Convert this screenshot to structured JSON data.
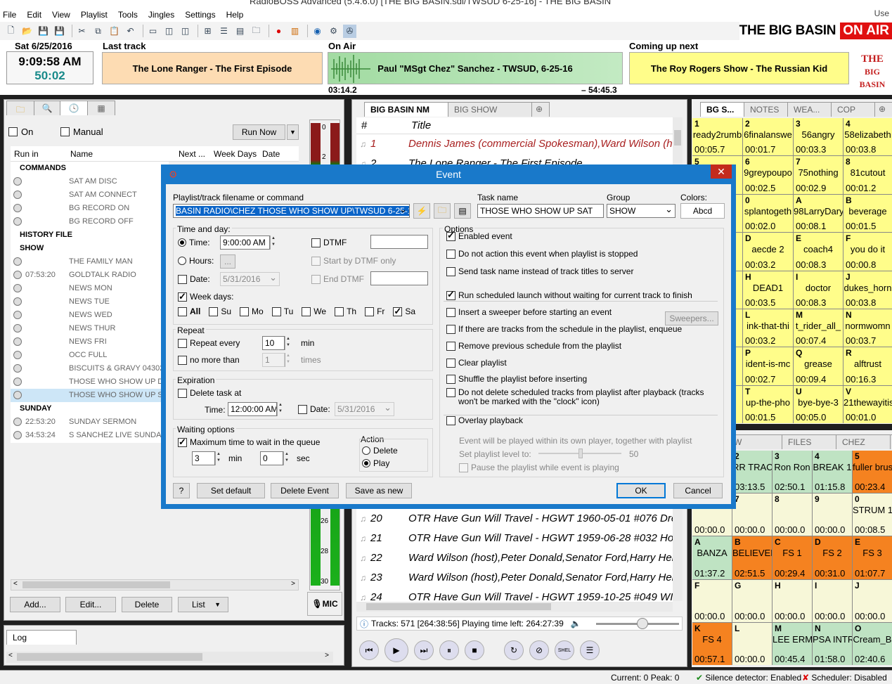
{
  "window": {
    "title": "RadioBOSS Advanced (5.4.6.0) [THE BIG BASIN.sdl/TWSUD 6-25-16] - THE BIG BASIN",
    "user_label": "Use"
  },
  "menu": [
    "File",
    "Edit",
    "View",
    "Playlist",
    "Tools",
    "Jingles",
    "Settings",
    "Help"
  ],
  "station": {
    "name": "THE BIG BASIN",
    "on_air_label": "ON AIR",
    "logo_line1": "THE",
    "logo_line2": "BIG BASIN"
  },
  "clock": {
    "date": "Sat 6/25/2016",
    "time": "9:09:58 AM",
    "countdown": "50:02"
  },
  "last_track": {
    "label": "Last track",
    "title": "The Lone Ranger - The First Episode"
  },
  "on_air": {
    "label": "On Air",
    "title": "Paul \"MSgt Chez\" Sanchez - TWSUD, 6-25-16",
    "elapsed": "03:14.2",
    "remaining": "– 54:45.3"
  },
  "coming_up": {
    "label": "Coming up next",
    "title": "The Roy Rogers Show - The Russian Kid"
  },
  "left_panel": {
    "on_label": "On",
    "manual_label": "Manual",
    "run_now": "Run Now",
    "columns": [
      "Run in",
      "Name",
      "Next ...",
      "Week Days",
      "Date"
    ],
    "rows": [
      {
        "type": "group",
        "name": "COMMANDS"
      },
      {
        "time": "",
        "name": "SAT AM DISC"
      },
      {
        "time": "",
        "name": "SAT AM CONNECT"
      },
      {
        "time": "",
        "name": "BG RECORD ON"
      },
      {
        "time": "",
        "name": "BG RECORD OFF"
      },
      {
        "type": "group",
        "name": "HISTORY FILE"
      },
      {
        "type": "group",
        "name": "SHOW"
      },
      {
        "time": "",
        "name": "THE FAMILY MAN"
      },
      {
        "time": "07:53:20",
        "name": "GOLDTALK RADIO"
      },
      {
        "time": "",
        "name": "NEWS MON"
      },
      {
        "time": "",
        "name": "NEWS TUE"
      },
      {
        "time": "",
        "name": "NEWS WED"
      },
      {
        "time": "",
        "name": "NEWS THUR"
      },
      {
        "time": "",
        "name": "NEWS FRI"
      },
      {
        "time": "",
        "name": "OCC FULL"
      },
      {
        "time": "",
        "name": "BISCUITS & GRAVY 043020"
      },
      {
        "time": "",
        "name": "THOSE WHO SHOW UP DEC"
      },
      {
        "time": "",
        "name": "THOSE WHO SHOW UP SAT",
        "selected": true
      },
      {
        "type": "group",
        "name": "SUNDAY"
      },
      {
        "time": "22:53:20",
        "name": "SUNDAY SERMON"
      },
      {
        "time": "34:53:24",
        "name": "S SANCHEZ LIVE SUNDAY"
      }
    ],
    "buttons": {
      "add": "Add...",
      "edit": "Edit...",
      "delete": "Delete",
      "list": "List"
    },
    "log_tab": "Log",
    "vu_ticks": [
      "0",
      "2",
      "26",
      "28",
      "30"
    ],
    "mic_label": "MIC"
  },
  "playlist": {
    "tabs": [
      "BIG BASIN NM",
      "BIG SHOW"
    ],
    "columns": [
      "#",
      "Title"
    ],
    "rows_top": [
      {
        "num": "1",
        "title": "Dennis James (commercial Spokesman),Ward Wilson (h"
      },
      {
        "num": "2",
        "title": "The Lone Ranger - The First Episode"
      }
    ],
    "rows_bottom": [
      {
        "num": "20",
        "title": "OTR Have Gun Will Travel - HGWT 1960-05-01 #076 Dre"
      },
      {
        "num": "21",
        "title": "OTR Have Gun Will Travel - HGWT 1959-06-28 #032 Ho"
      },
      {
        "num": "22",
        "title": "Ward Wilson (host),Peter Donald,Senator Ford,Harry Her"
      },
      {
        "num": "23",
        "title": "Ward Wilson (host),Peter Donald,Senator Ford,Harry Her"
      },
      {
        "num": "24",
        "title": "OTR Have Gun Will Travel - HGWT 1959-10-25 #049 WI"
      }
    ],
    "status": "Tracks: 571 [264:38:56] Playing time left: 264:27:39"
  },
  "cart_top": {
    "tabs": [
      "BG S...",
      "NOTES",
      "WEA...",
      "COP"
    ],
    "cells": [
      {
        "k": "1",
        "n": "ready2rumb",
        "t": "00:05.7"
      },
      {
        "k": "2",
        "n": "6finalanswe",
        "t": "00:01.7"
      },
      {
        "k": "3",
        "n": "56angry",
        "t": "00:03.3"
      },
      {
        "k": "4",
        "n": "58elizabeth",
        "t": "00:03.8"
      },
      {
        "k": "5",
        "n": "",
        "t": ""
      },
      {
        "k": "6",
        "n": "9greypoupo",
        "t": "00:02.5"
      },
      {
        "k": "7",
        "n": "75nothing",
        "t": "00:02.9"
      },
      {
        "k": "8",
        "n": "81cutout",
        "t": "00:01.2"
      },
      {
        "k": "9",
        "n": "",
        "t": ""
      },
      {
        "k": "0",
        "n": "splantogeth",
        "t": "00:02.0"
      },
      {
        "k": "A",
        "n": "98LarryDary",
        "t": "00:08.1"
      },
      {
        "k": "B",
        "n": "beverage",
        "t": "00:01.5"
      },
      {
        "k": "C",
        "n": "",
        "t": ""
      },
      {
        "k": "D",
        "n": "aecde 2",
        "t": "00:03.2"
      },
      {
        "k": "E",
        "n": "coach4",
        "t": "00:08.3"
      },
      {
        "k": "F",
        "n": "you do it",
        "t": "00:00.8"
      },
      {
        "k": "G",
        "n": "",
        "t": ""
      },
      {
        "k": "H",
        "n": "DEAD1",
        "t": "00:03.5"
      },
      {
        "k": "I",
        "n": "doctor",
        "t": "00:08.3"
      },
      {
        "k": "J",
        "n": "dukes_horn",
        "t": "00:03.8"
      },
      {
        "k": "K",
        "n": "e",
        "t": ""
      },
      {
        "k": "L",
        "n": "ink-that-thi",
        "t": "00:03.2"
      },
      {
        "k": "M",
        "n": "t_rider_all_",
        "t": "00:07.4"
      },
      {
        "k": "N",
        "n": "normwomn",
        "t": "00:03.7"
      },
      {
        "k": "O",
        "n": "",
        "t": ""
      },
      {
        "k": "P",
        "n": "ident-is-mc",
        "t": "00:02.7"
      },
      {
        "k": "Q",
        "n": "grease",
        "t": "00:09.4"
      },
      {
        "k": "R",
        "n": "alftrust",
        "t": "00:16.3"
      },
      {
        "k": "S",
        "n": "",
        "t": ""
      },
      {
        "k": "T",
        "n": "up-the-pho",
        "t": "00:01.5"
      },
      {
        "k": "U",
        "n": "bye-bye-3",
        "t": "00:05.0"
      },
      {
        "k": "V",
        "n": "21thewayitis",
        "t": "00:01.0"
      }
    ]
  },
  "cart_bottom": {
    "tabs": [
      "W",
      "FILES",
      "CHEZ"
    ],
    "cells": [
      {
        "k": "1",
        "n": "",
        "t": "",
        "c": "#f7f7d8"
      },
      {
        "k": "2",
        "n": "RR TRACK",
        "t": "03:13.5",
        "c": "#bfe3c3"
      },
      {
        "k": "3",
        "n": "Ron Ron",
        "t": "02:50.1",
        "c": "#bfe3c3"
      },
      {
        "k": "4",
        "n": "BREAK 1",
        "t": "01:15.8",
        "c": "#bfe3c3"
      },
      {
        "k": "5",
        "n": "fuller brush",
        "t": "00:23.4",
        "c": "#f58220"
      },
      {
        "k": "6",
        "n": "",
        "t": "00:00.0",
        "c": "#f7f7d8"
      },
      {
        "k": "7",
        "n": "",
        "t": "00:00.0",
        "c": "#f7f7d8"
      },
      {
        "k": "8",
        "n": "",
        "t": "00:00.0",
        "c": "#f7f7d8"
      },
      {
        "k": "9",
        "n": "",
        "t": "00:00.0",
        "c": "#f7f7d8"
      },
      {
        "k": "0",
        "n": "STRUM 1",
        "t": "00:08.5",
        "c": "#f7f7d8"
      },
      {
        "k": "A",
        "n": "BANZA",
        "t": "01:37.2",
        "c": "#bfe3c3"
      },
      {
        "k": "B",
        "n": "BELIEVER",
        "t": "02:51.5",
        "c": "#f58220"
      },
      {
        "k": "C",
        "n": "FS 1",
        "t": "00:29.4",
        "c": "#f58220"
      },
      {
        "k": "D",
        "n": "FS 2",
        "t": "00:31.0",
        "c": "#f58220"
      },
      {
        "k": "E",
        "n": "FS 3",
        "t": "01:07.7",
        "c": "#f58220"
      },
      {
        "k": "F",
        "n": "",
        "t": "00:00.0",
        "c": "#f7f7d8"
      },
      {
        "k": "G",
        "n": "",
        "t": "00:00.0",
        "c": "#f7f7d8"
      },
      {
        "k": "H",
        "n": "",
        "t": "00:00.0",
        "c": "#f7f7d8"
      },
      {
        "k": "I",
        "n": "",
        "t": "00:00.0",
        "c": "#f7f7d8"
      },
      {
        "k": "J",
        "n": "",
        "t": "00:00.0",
        "c": "#f7f7d8"
      },
      {
        "k": "K",
        "n": "FS 4",
        "t": "00:57.1",
        "c": "#f58220"
      },
      {
        "k": "L",
        "n": "",
        "t": "00:00.0",
        "c": "#f7f7d8"
      },
      {
        "k": "M",
        "n": "LEE ERMY",
        "t": "00:45.4",
        "c": "#bfe3c3"
      },
      {
        "k": "N",
        "n": "PSA INTRO",
        "t": "01:58.0",
        "c": "#bfe3c3"
      },
      {
        "k": "O",
        "n": "Cream_B",
        "t": "02:40.6",
        "c": "#bfe3c3"
      }
    ]
  },
  "status_bar": {
    "current": "Current: 0 Peak: 0",
    "silence": "Silence detector: Enabled",
    "scheduler": "Scheduler: Disabled"
  },
  "dialog": {
    "title": "Event",
    "file_label": "Playlist/track filename or command",
    "file_value": "BASIN RADIO\\CHEZ THOSE WHO SHOW UP\\TWSUD 6-25-16.mp3",
    "task_label": "Task name",
    "task_value": "THOSE WHO SHOW UP SAT",
    "group_label": "Group",
    "group_value": "SHOW",
    "colors_label": "Colors:",
    "colors_value": "Abcd",
    "time_day_label": "Time and day:",
    "time_label": "Time:",
    "time_value": "9:00:00 AM",
    "hours_label": "Hours:",
    "hours_value": "...",
    "date_label": "Date:",
    "date_value": "5/31/2016",
    "dtmf_label": "DTMF",
    "start_dtmf": "Start by DTMF only",
    "end_dtmf": "End DTMF",
    "weekdays_label": "Week days:",
    "days": [
      {
        "l": "All",
        "on": false,
        "b": true
      },
      {
        "l": "Su",
        "on": false
      },
      {
        "l": "Mo",
        "on": false
      },
      {
        "l": "Tu",
        "on": false
      },
      {
        "l": "We",
        "on": false
      },
      {
        "l": "Th",
        "on": false
      },
      {
        "l": "Fr",
        "on": false
      },
      {
        "l": "Sa",
        "on": true
      }
    ],
    "repeat_label": "Repeat",
    "repeat_every": "Repeat every",
    "repeat_value": "10",
    "repeat_unit": "min",
    "no_more_than": "no more than",
    "no_more_value": "1",
    "no_more_unit": "times",
    "expiration_label": "Expiration",
    "delete_task_at": "Delete task at",
    "exp_time_label": "Time:",
    "exp_time_value": "12:00:00 AM",
    "exp_date_label": "Date:",
    "exp_date_value": "5/31/2016",
    "waiting_label": "Waiting options",
    "max_wait": "Maximum time to wait in the queue",
    "wait_min": "3",
    "min_label": "min",
    "wait_sec": "0",
    "sec_label": "sec",
    "action_label": "Action",
    "action_delete": "Delete",
    "action_play": "Play",
    "options_label": "Options",
    "options": [
      {
        "l": "Enabled event",
        "on": true
      },
      {
        "l": "Do not action this event when playlist is stopped",
        "on": false
      },
      {
        "l": "Send task name instead of track titles to server",
        "on": false
      },
      {
        "l": "Run scheduled launch without waiting for current track to finish",
        "on": true
      },
      {
        "l": "Insert a sweeper before starting an event",
        "on": false
      },
      {
        "l": "If there are tracks from the schedule in the playlist, enqueue",
        "on": false
      },
      {
        "l": "Remove previous schedule from the playlist",
        "on": false
      },
      {
        "l": "Clear playlist",
        "on": false
      },
      {
        "l": "Shuffle the playlist before inserting",
        "on": false
      },
      {
        "l": "Do not delete scheduled tracks from playlist after playback (tracks won't be marked with the \"clock\" icon)",
        "on": false
      },
      {
        "l": "Overlay playback",
        "on": false
      }
    ],
    "sweepers_btn": "Sweepers...",
    "overlay_note": "Event will be played within its own player, together with playlist",
    "set_level_label": "Set playlist level to:",
    "set_level_value": "50",
    "pause_playlist": "Pause the playlist while event is playing",
    "help_btn": "?",
    "set_default": "Set default",
    "delete_event": "Delete Event",
    "save_as_new": "Save as new",
    "ok": "OK",
    "cancel": "Cancel"
  }
}
